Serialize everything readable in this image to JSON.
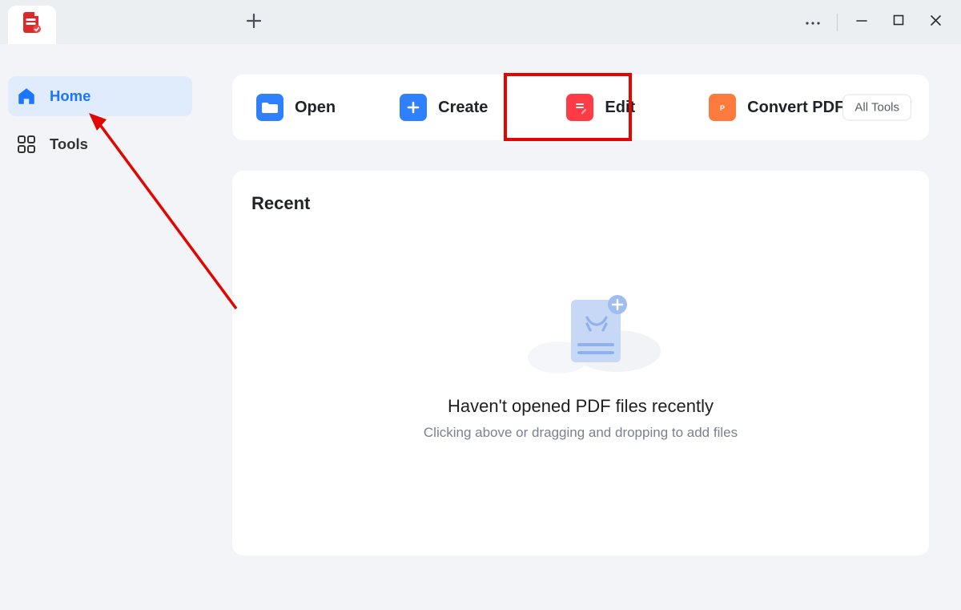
{
  "titlebar": {
    "new_tab_tooltip": "New Tab",
    "more_tooltip": "More",
    "minimize_tooltip": "Minimize",
    "maximize_tooltip": "Maximize",
    "close_tooltip": "Close"
  },
  "sidebar": {
    "items": [
      {
        "label": "Home",
        "active": true
      },
      {
        "label": "Tools",
        "active": false
      }
    ]
  },
  "toolbar": {
    "open_label": "Open",
    "create_label": "Create",
    "edit_label": "Edit",
    "convert_label": "Convert PDF",
    "all_tools_label": "All Tools"
  },
  "recent": {
    "title": "Recent",
    "empty_title": "Haven't opened PDF files recently",
    "empty_subtitle": "Clicking above or dragging and dropping to add files"
  },
  "annotation": {
    "type": "arrow",
    "target": "home-sidebar-item",
    "color": "#e10600"
  }
}
